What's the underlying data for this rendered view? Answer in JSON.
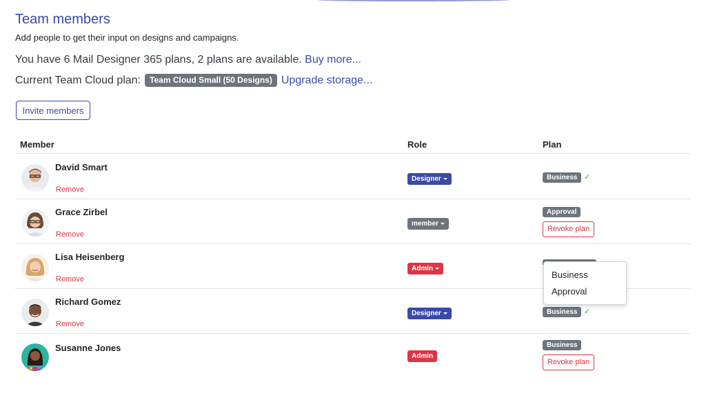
{
  "header": {
    "title": "Team members",
    "subtitle": "Add people to get their input on designs and campaigns."
  },
  "plans": {
    "summary_text": "You have 6 Mail Designer 365 plans, 2 plans are available.",
    "buy_more_label": "Buy more...",
    "cloud_label": "Current Team Cloud plan:",
    "cloud_plan": "Team Cloud Small (50 Designs)",
    "upgrade_label": "Upgrade storage..."
  },
  "invite_label": "Invite members",
  "table": {
    "columns": [
      "Member",
      "Role",
      "Plan"
    ],
    "remove_label": "Remove",
    "revoke_label": "Revoke plan",
    "rows": [
      {
        "name": "David Smart",
        "role": "Designer",
        "plan": "Business",
        "check": "✓"
      },
      {
        "name": "Grace Zirbel",
        "role": "member",
        "plan": "Approval"
      },
      {
        "name": "Lisa Heisenberg",
        "role": "Admin",
        "plan": ""
      },
      {
        "name": "Richard Gomez",
        "role": "Designer",
        "plan": "Business",
        "check": "✓"
      },
      {
        "name": "Susanne Jones",
        "role": "Admin",
        "plan": "Business"
      }
    ]
  },
  "plan_dropdown": {
    "options": [
      "Business",
      "Approval"
    ]
  },
  "colors": {
    "accent": "#3b4aa8",
    "danger": "#dc3545",
    "neutral_badge": "#6c757d",
    "success": "#28a745"
  }
}
